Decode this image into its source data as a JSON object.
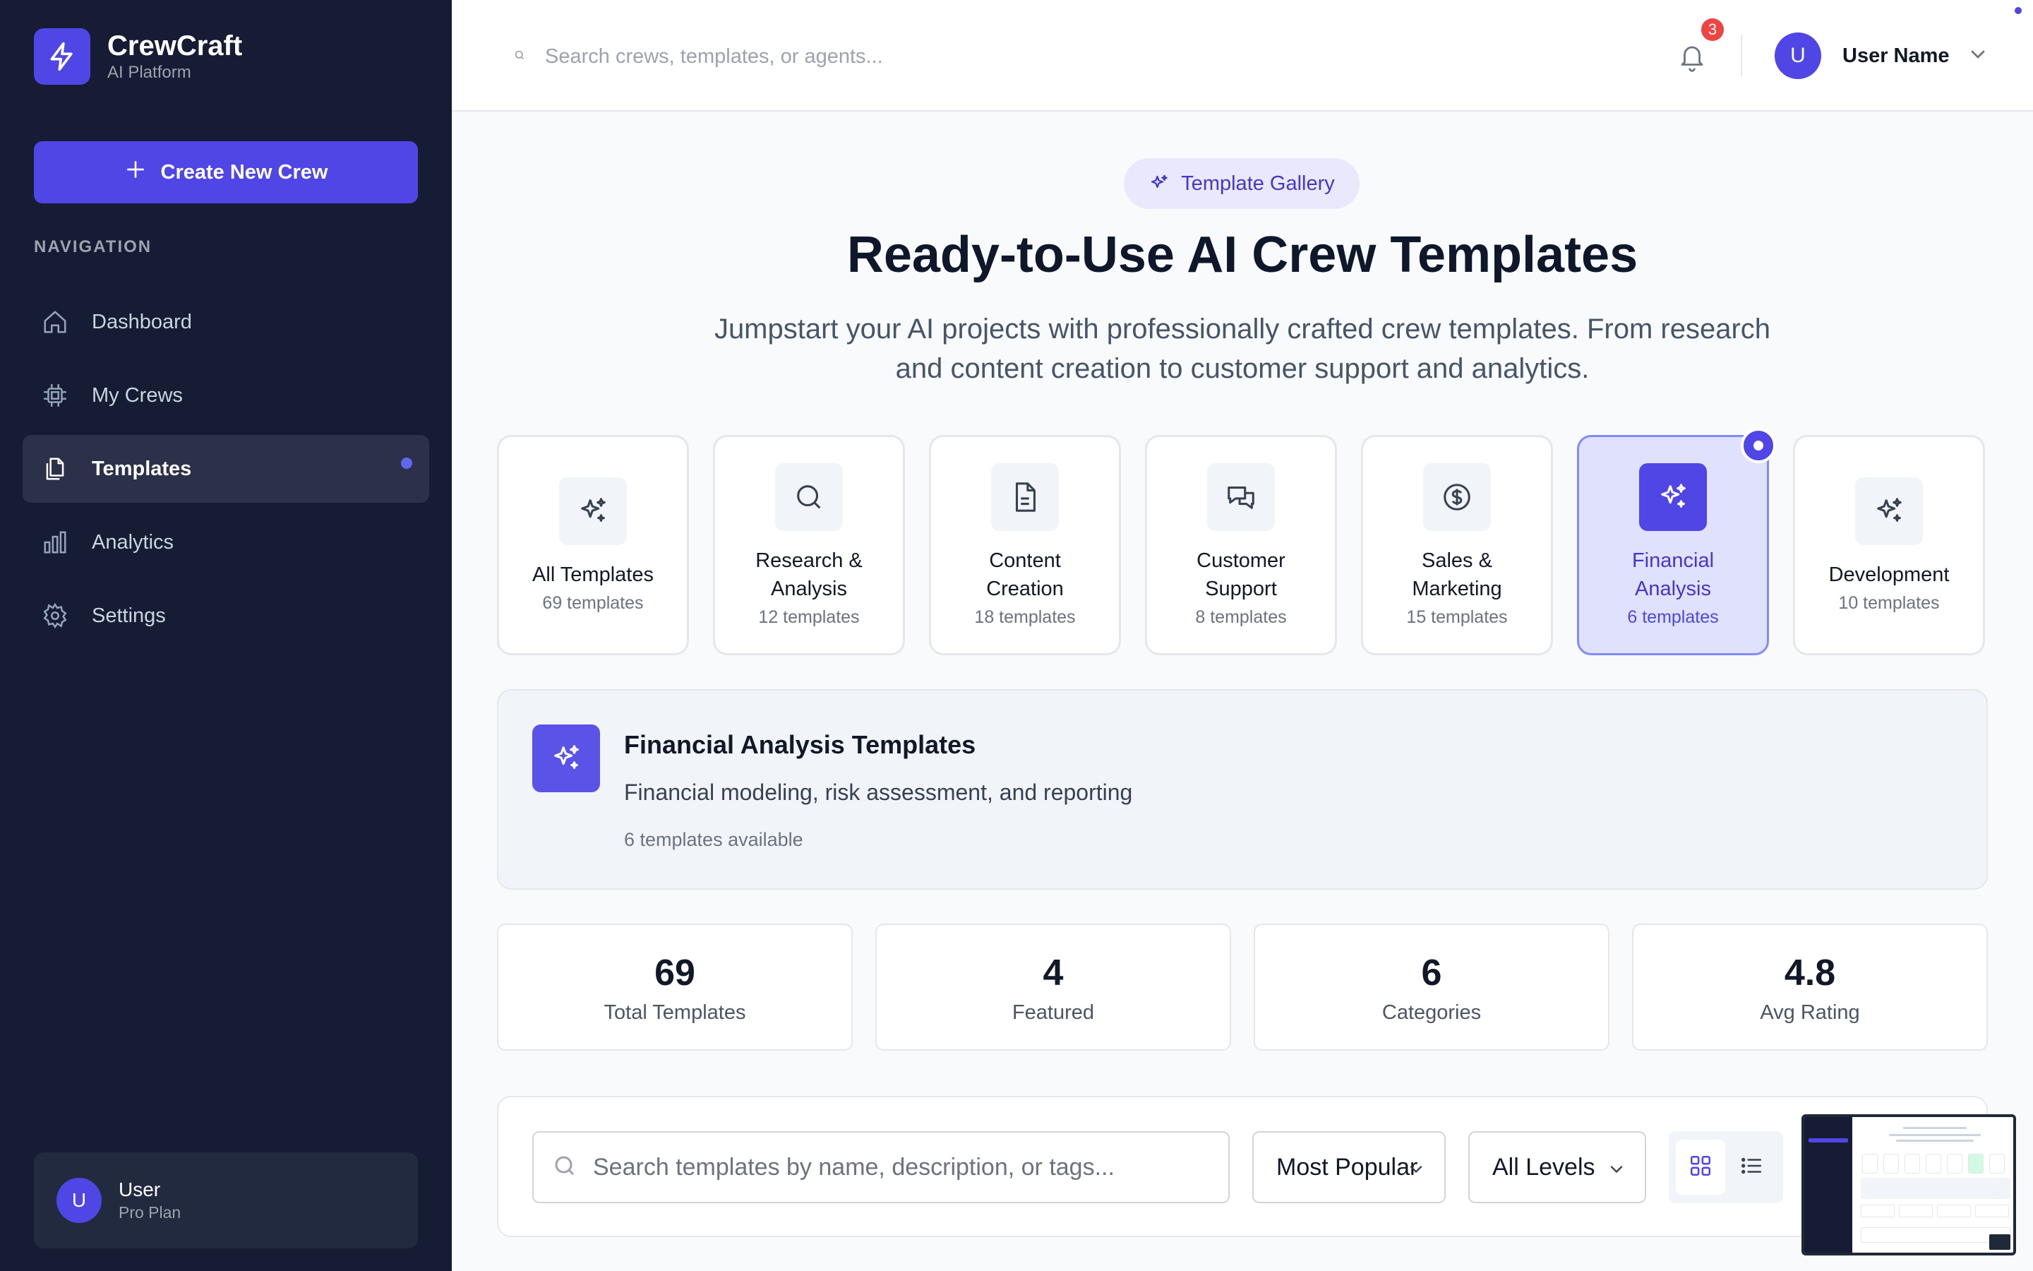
{
  "brand": {
    "name": "CrewCraft",
    "subtitle": "AI Platform",
    "logo_icon": "bolt-icon"
  },
  "sidebar": {
    "create_button": "Create New Crew",
    "nav_heading": "NAVIGATION",
    "items": [
      {
        "label": "Dashboard",
        "icon": "home-icon",
        "active": false
      },
      {
        "label": "My Crews",
        "icon": "cpu-icon",
        "active": false
      },
      {
        "label": "Templates",
        "icon": "documents-icon",
        "active": true
      },
      {
        "label": "Analytics",
        "icon": "bar-chart-icon",
        "active": false
      },
      {
        "label": "Settings",
        "icon": "gear-icon",
        "active": false
      }
    ],
    "user": {
      "initial": "U",
      "name": "User",
      "plan": "Pro Plan"
    }
  },
  "topbar": {
    "search_placeholder": "Search crews, templates, or agents...",
    "notification_count": "3",
    "user_initial": "U",
    "user_name": "User Name"
  },
  "hero": {
    "badge": "Template Gallery",
    "title": "Ready-to-Use AI Crew Templates",
    "subtitle": "Jumpstart your AI projects with professionally crafted crew templates. From research and content creation to customer support and analytics."
  },
  "categories": [
    {
      "name": "All Templates",
      "count": "69 templates",
      "icon": "sparkles-icon",
      "active": false
    },
    {
      "name": "Research & Analysis",
      "count": "12 templates",
      "icon": "search-icon",
      "active": false
    },
    {
      "name": "Content Creation",
      "count": "18 templates",
      "icon": "document-icon",
      "active": false
    },
    {
      "name": "Customer Support",
      "count": "8 templates",
      "icon": "chat-bubbles-icon",
      "active": false
    },
    {
      "name": "Sales & Marketing",
      "count": "15 templates",
      "icon": "dollar-icon",
      "active": false
    },
    {
      "name": "Financial Analysis",
      "count": "6 templates",
      "icon": "sparkles-icon",
      "active": true
    },
    {
      "name": "Development",
      "count": "10 templates",
      "icon": "sparkles-icon",
      "active": false
    }
  ],
  "info": {
    "title": "Financial Analysis Templates",
    "description": "Financial modeling, risk assessment, and reporting",
    "count": "6 templates available"
  },
  "stats": [
    {
      "value": "69",
      "label": "Total Templates"
    },
    {
      "value": "4",
      "label": "Featured"
    },
    {
      "value": "6",
      "label": "Categories"
    },
    {
      "value": "4.8",
      "label": "Avg Rating"
    }
  ],
  "filters": {
    "search_placeholder": "Search templates by name, description, or tags...",
    "sort_value": "Most Popular",
    "level_value": "All Levels",
    "view_mode": "grid"
  },
  "colors": {
    "accent": "#4f46e5",
    "sidebar_bg": "#161c33",
    "badge_red": "#ef4444"
  }
}
